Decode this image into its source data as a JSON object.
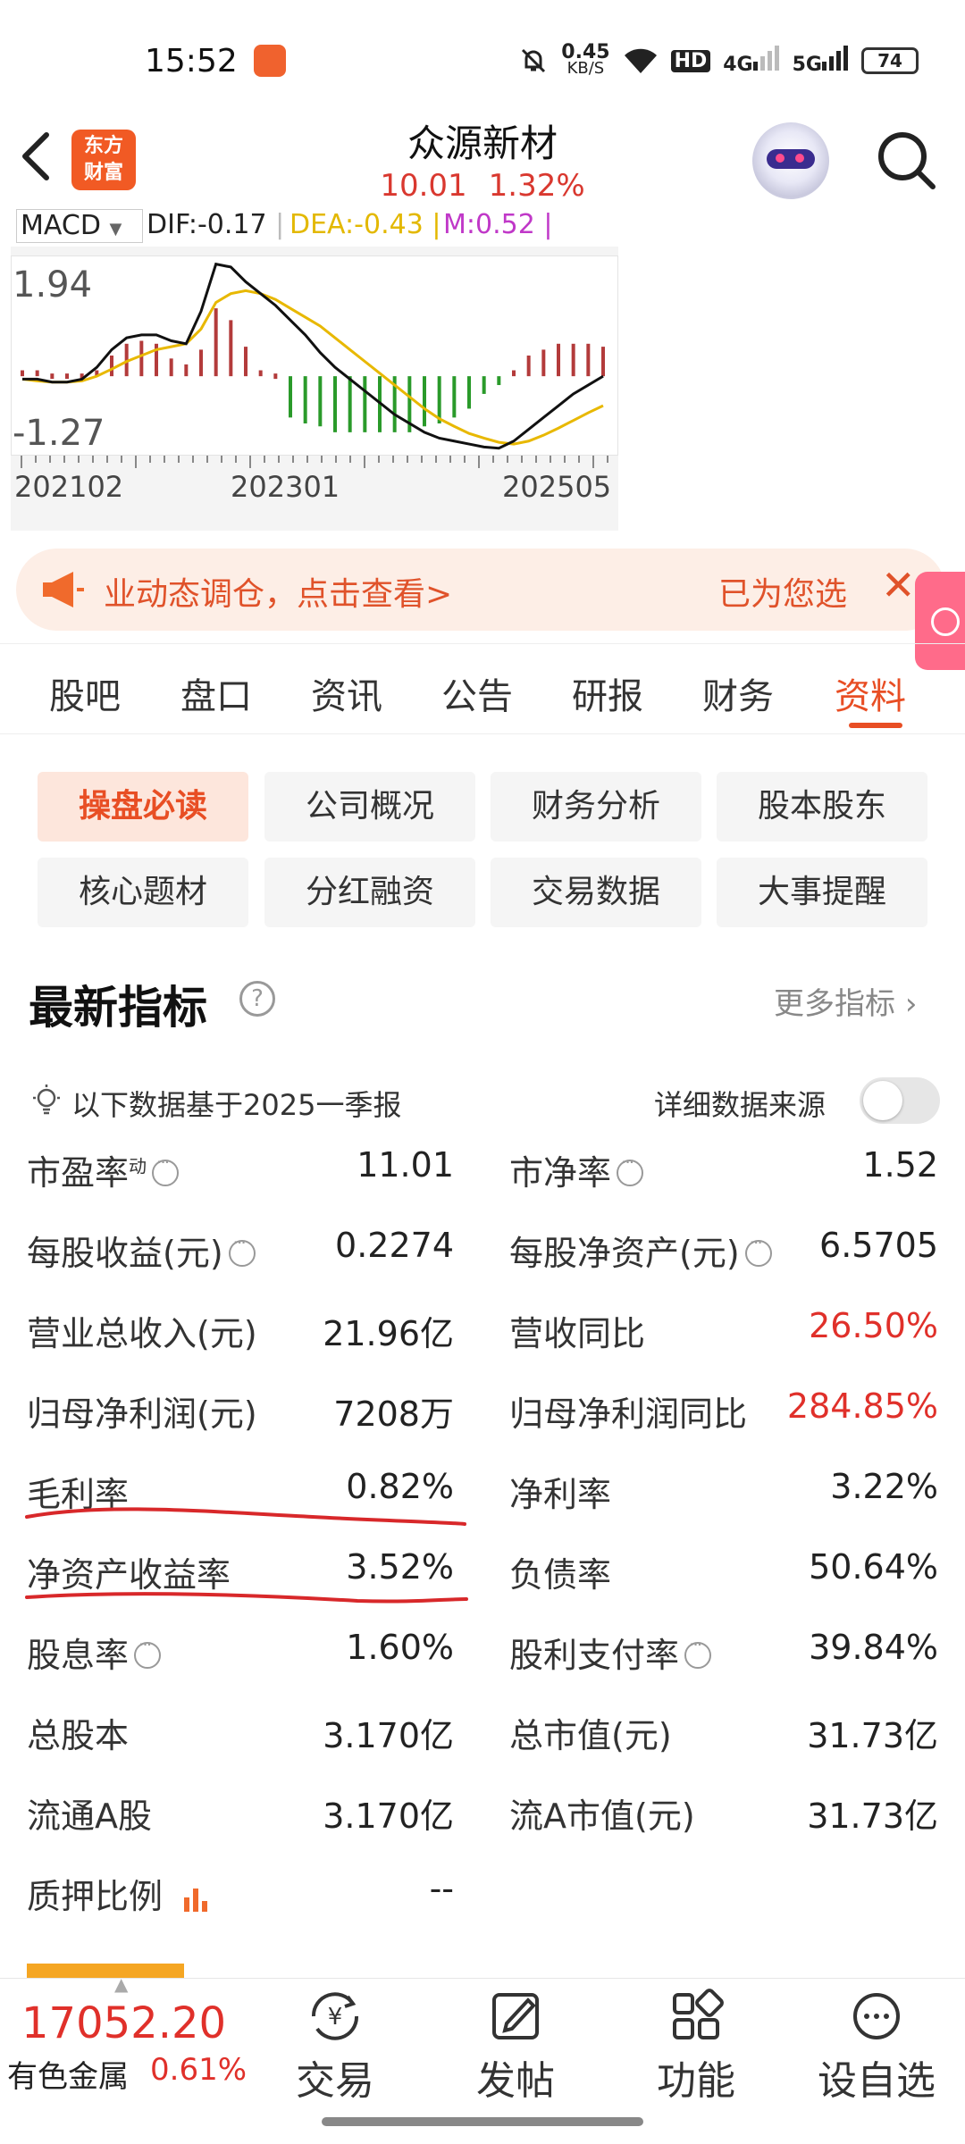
{
  "status_bar": {
    "time": "15:52",
    "net_speed_top": "0.45",
    "net_speed_unit": "KB/S",
    "hd": "HD",
    "sig1": "4G",
    "sig2": "5G",
    "battery": "74"
  },
  "header": {
    "logo_line1": "东方",
    "logo_line2": "财富",
    "stock_name": "众源新材",
    "price": "10.01",
    "change_pct": "1.32%"
  },
  "macd": {
    "selector": "MACD",
    "dif": "DIF:-0.17",
    "dea": "DEA:-0.43",
    "m": "M:0.52"
  },
  "chart_data": {
    "type": "line",
    "title": "",
    "y_top_label": "1.94",
    "y_bottom_label": "-1.27",
    "x_ticks": [
      "202102",
      "202301",
      "202505"
    ],
    "ylim": [
      -1.27,
      1.94
    ],
    "series": [
      {
        "name": "DIF",
        "values": [
          -0.05,
          -0.05,
          -0.1,
          -0.1,
          -0.05,
          0.15,
          0.45,
          0.65,
          0.7,
          0.7,
          0.6,
          0.55,
          1.1,
          1.9,
          1.85,
          1.6,
          1.4,
          1.2,
          0.95,
          0.7,
          0.4,
          0.15,
          -0.05,
          -0.25,
          -0.45,
          -0.65,
          -0.8,
          -0.95,
          -1.05,
          -1.1,
          -1.15,
          -1.2,
          -1.22,
          -1.1,
          -0.9,
          -0.7,
          -0.5,
          -0.3,
          -0.15,
          0.0
        ]
      },
      {
        "name": "DEA",
        "values": [
          -0.05,
          -0.08,
          -0.1,
          -0.1,
          -0.08,
          0.0,
          0.12,
          0.25,
          0.35,
          0.45,
          0.5,
          0.55,
          0.8,
          1.25,
          1.4,
          1.45,
          1.4,
          1.3,
          1.15,
          1.0,
          0.85,
          0.65,
          0.45,
          0.25,
          0.05,
          -0.15,
          -0.35,
          -0.55,
          -0.72,
          -0.85,
          -0.97,
          -1.05,
          -1.12,
          -1.15,
          -1.1,
          -1.0,
          -0.88,
          -0.75,
          -0.62,
          -0.5
        ]
      },
      {
        "name": "MACD",
        "values": [
          0.1,
          0.1,
          0.05,
          0.05,
          0.05,
          0.1,
          0.35,
          0.55,
          0.6,
          0.55,
          0.3,
          0.2,
          0.45,
          1.15,
          0.95,
          0.5,
          0.1,
          0.05,
          -0.7,
          -0.8,
          -0.85,
          -0.95,
          -0.95,
          -0.95,
          -0.95,
          -0.95,
          -0.95,
          -0.85,
          -0.8,
          -0.7,
          -0.55,
          -0.3,
          -0.15,
          0.1,
          0.35,
          0.45,
          0.55,
          0.55,
          0.55,
          0.5
        ]
      }
    ],
    "colors": {
      "dif": "#111111",
      "dea": "#e8b800",
      "up": "#b33b3b",
      "down": "#2a9a2a"
    }
  },
  "banner": {
    "text": "业动态调仓，点击查看>",
    "right_text": "已为您选",
    "close": "✕"
  },
  "tabs": [
    "股吧",
    "盘口",
    "资讯",
    "公告",
    "研报",
    "财务",
    "资料"
  ],
  "sub_buttons": [
    "操盘必读",
    "公司概况",
    "财务分析",
    "股本股东",
    "核心题材",
    "分红融资",
    "交易数据",
    "大事提醒"
  ],
  "indicators": {
    "title": "最新指标",
    "help": "?",
    "more": "更多指标",
    "more_arrow": "›",
    "note": "以下数据基于2025一季报",
    "source": "详细数据来源",
    "rows": [
      {
        "l_label": "市盈率",
        "l_sup": "动",
        "l_val": "11.01",
        "r_label": "市净率",
        "r_val": "1.52"
      },
      {
        "l_label": "每股收益(元)",
        "l_val": "0.2274",
        "r_label": "每股净资产(元)",
        "r_val": "6.5705"
      },
      {
        "l_label": "营业总收入(元)",
        "l_val": "21.96亿",
        "r_label": "营收同比",
        "r_val": "26.50%"
      },
      {
        "l_label": "归母净利润(元)",
        "l_val": "7208万",
        "r_label": "归母净利润同比",
        "r_val": "284.85%"
      },
      {
        "l_label": "毛利率",
        "l_val": "0.82%",
        "r_label": "净利率",
        "r_val": "3.22%"
      },
      {
        "l_label": "净资产收益率",
        "l_val": "3.52%",
        "r_label": "负债率",
        "r_val": "50.64%"
      },
      {
        "l_label": "股息率",
        "l_val": "1.60%",
        "r_label": "股利支付率",
        "r_val": "39.84%"
      },
      {
        "l_label": "总股本",
        "l_val": "3.170亿",
        "r_label": "总市值(元)",
        "r_val": "31.73亿"
      },
      {
        "l_label": "流通A股",
        "l_val": "3.170亿",
        "r_label": "流A市值(元)",
        "r_val": "31.73亿"
      },
      {
        "l_label": "质押比例",
        "l_val": "--"
      }
    ]
  },
  "bottom_bar": {
    "index_value": "17052.20",
    "index_name": "有色金属",
    "index_change": "0.61%",
    "items": [
      "交易",
      "发帖",
      "功能",
      "设自选"
    ]
  }
}
